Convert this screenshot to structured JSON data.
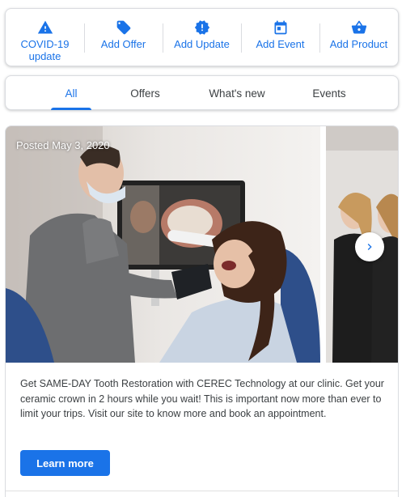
{
  "actions": [
    {
      "label": "COVID-19\nupdate",
      "icon": "warning-icon"
    },
    {
      "label": "Add Offer",
      "icon": "tag-icon"
    },
    {
      "label": "Add Update",
      "icon": "badge-alert-icon"
    },
    {
      "label": "Add Event",
      "icon": "calendar-icon"
    },
    {
      "label": "Add Product",
      "icon": "shopping-basket-icon"
    }
  ],
  "tabs": [
    {
      "label": "All",
      "active": true
    },
    {
      "label": "Offers",
      "active": false
    },
    {
      "label": "What's new",
      "active": false
    },
    {
      "label": "Events",
      "active": false
    }
  ],
  "post": {
    "posted_date": "Posted May 3, 2020",
    "body": "Get SAME-DAY Tooth Restoration with CEREC Technology at our clinic. Get your ceramic crown in 2 hours while you wait! This is important now more than ever to limit your trips. Visit our site to know more and book an appointment.",
    "cta_label": "Learn more"
  },
  "colors": {
    "accent": "#1a73e8",
    "text": "#3c4043",
    "border": "#dadce0"
  }
}
